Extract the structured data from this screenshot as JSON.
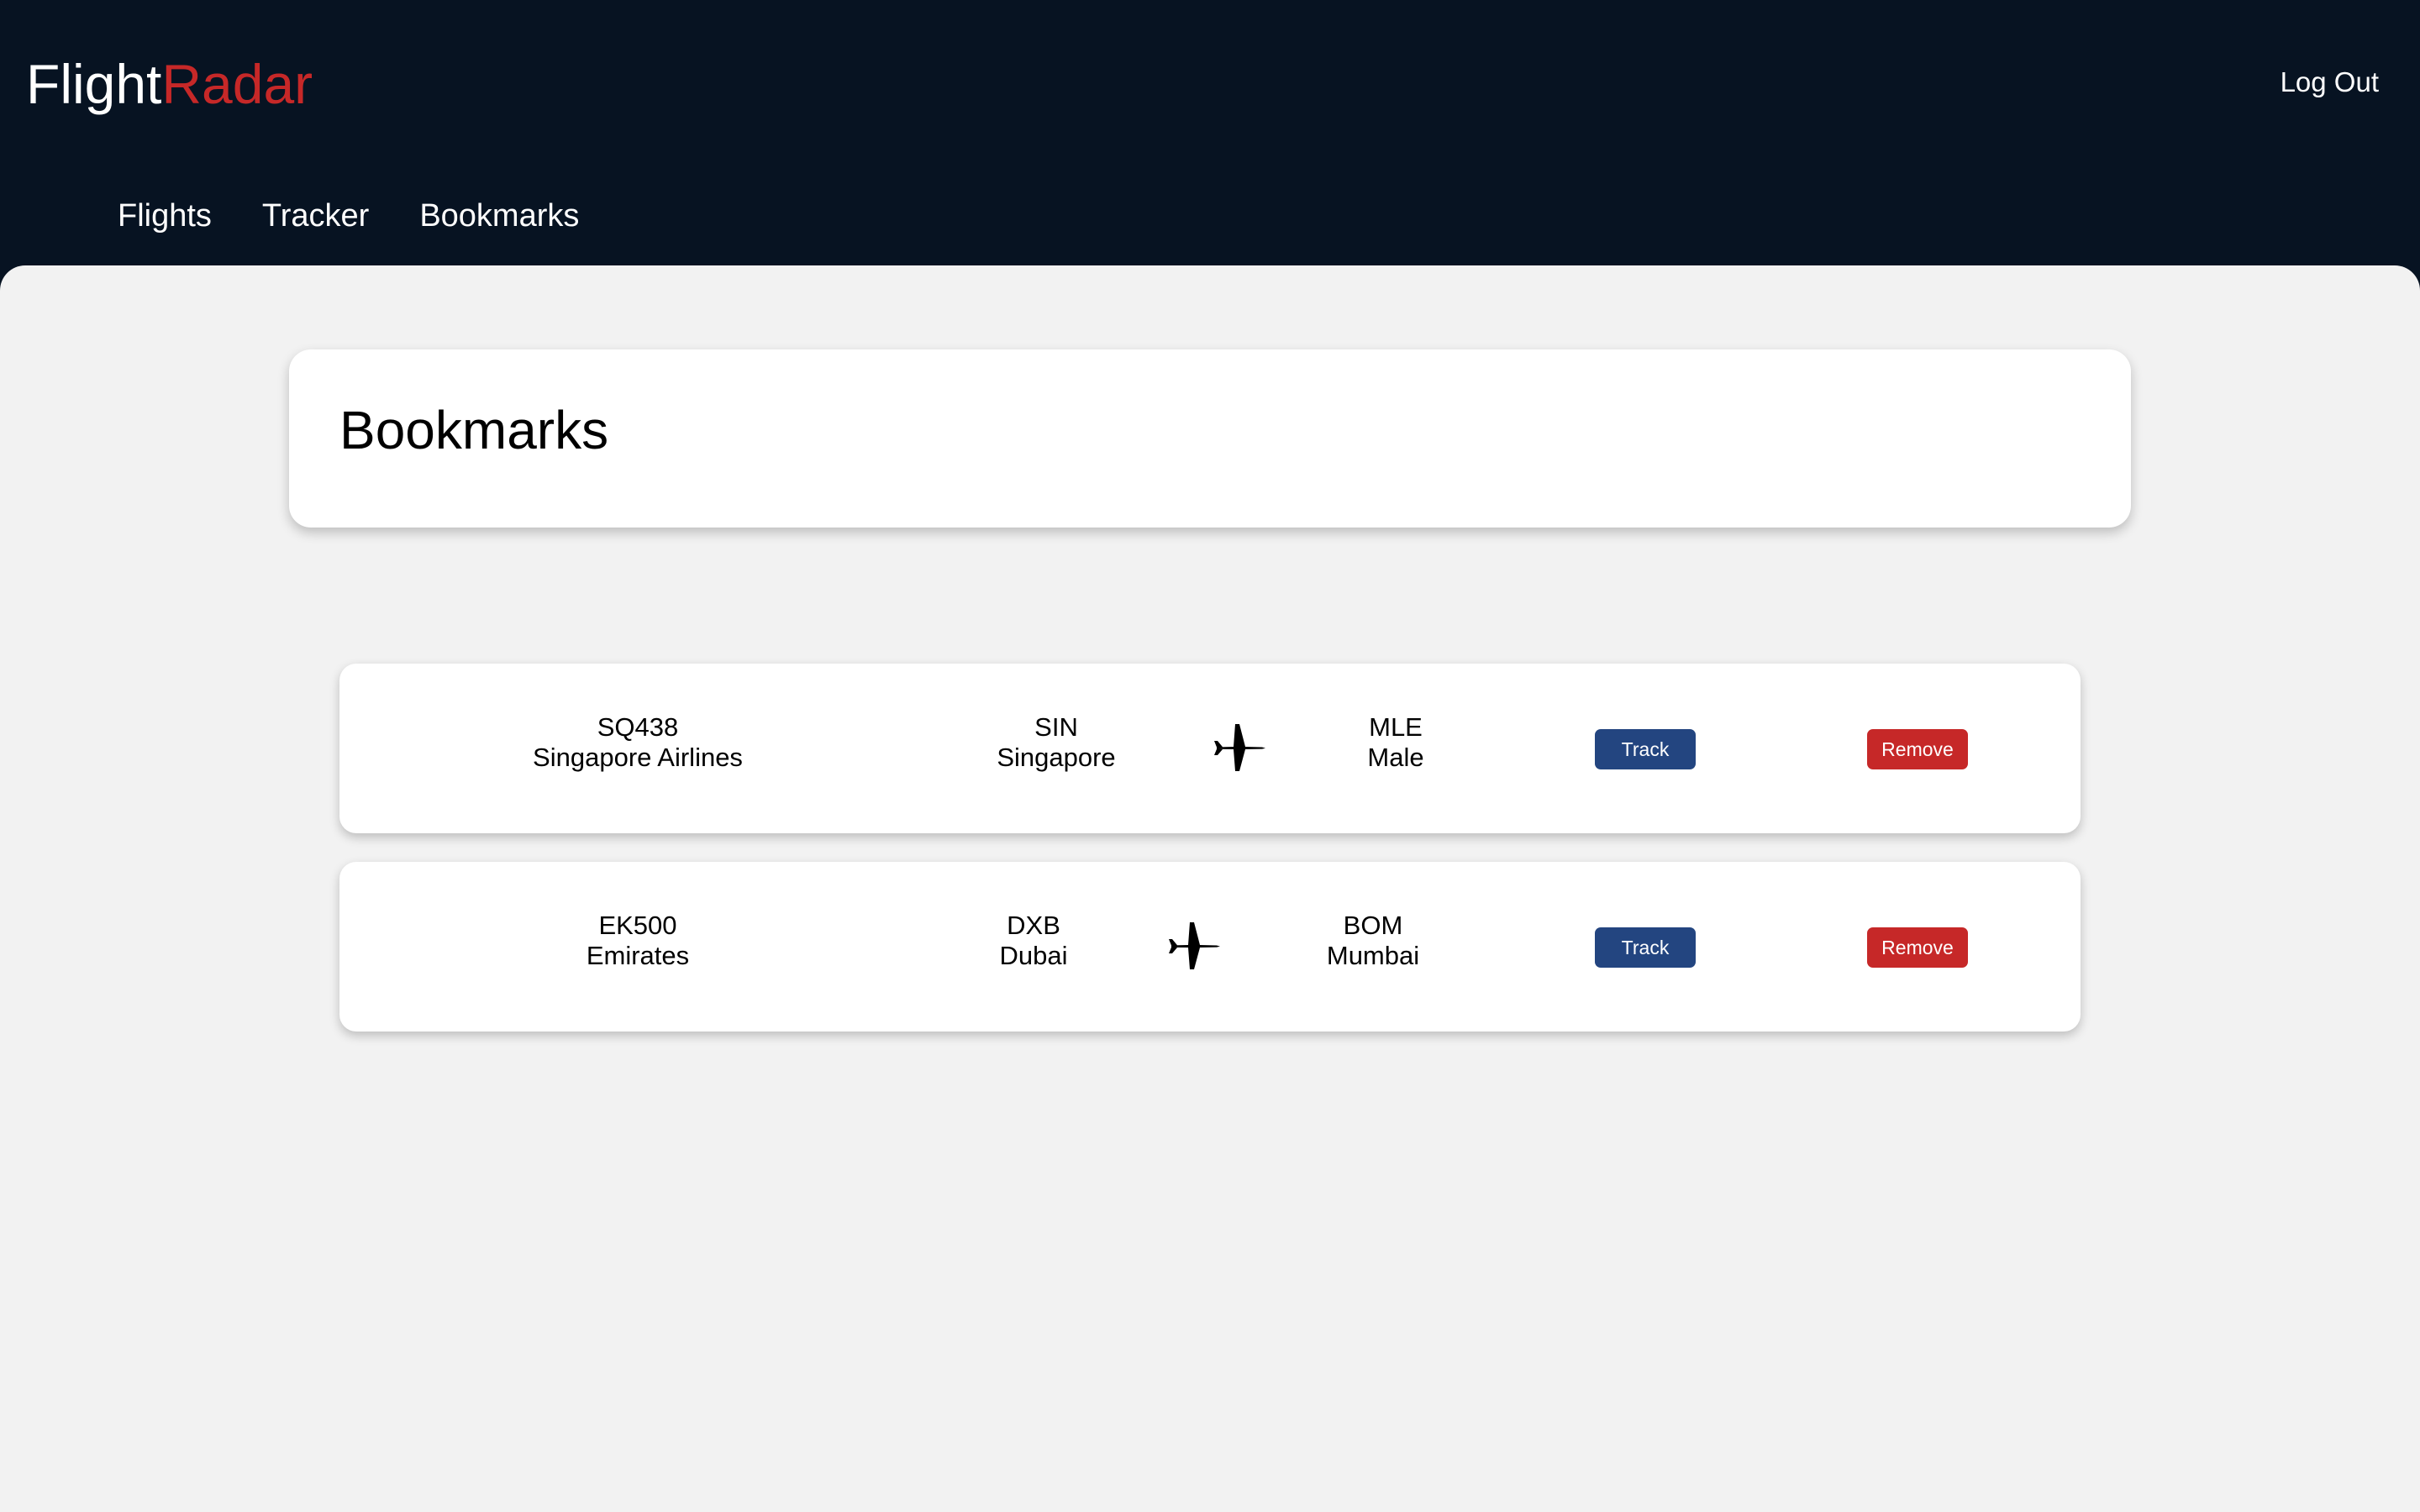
{
  "header": {
    "logo_part1": "Flight",
    "logo_part2": "Radar",
    "logout_label": "Log Out",
    "nav": [
      "Flights",
      "Tracker",
      "Bookmarks"
    ]
  },
  "page": {
    "title": "Bookmarks"
  },
  "bookmarks": [
    {
      "flight_number": "SQ438",
      "airline": "Singapore Airlines",
      "origin_code": "SIN",
      "origin_city": "Singapore",
      "destination_code": "MLE",
      "destination_city": "Male",
      "track_label": "Track",
      "remove_label": "Remove"
    },
    {
      "flight_number": "EK500",
      "airline": "Emirates",
      "origin_code": "DXB",
      "origin_city": "Dubai",
      "destination_code": "BOM",
      "destination_city": "Mumbai",
      "track_label": "Track",
      "remove_label": "Remove"
    }
  ],
  "icons": {
    "route": "airplane-icon"
  },
  "colors": {
    "header_bg": "#071322",
    "brand_accent": "#c62828",
    "track_button": "#234580",
    "remove_button": "#c62828",
    "page_bg": "#f2f2f2"
  }
}
